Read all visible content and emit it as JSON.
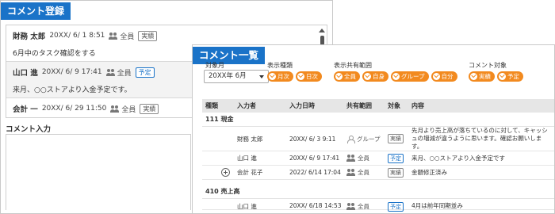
{
  "register": {
    "title": "コメント登録",
    "comments": [
      {
        "name": "財務 太郎",
        "date": "20XX/ 6/ 1 8:51",
        "share": "全員",
        "tag": "実績",
        "tag_style": "gray",
        "body": "6月中のタスク確認をする"
      },
      {
        "name": "山口 進",
        "date": "20XX/ 6/ 9 17:41",
        "share": "全員",
        "tag": "予定",
        "tag_style": "blue",
        "body": "来月、○○ストアより入金予定です。"
      },
      {
        "name": "会計 一",
        "date": "20XX/ 6/ 29 11:50",
        "share": "全員",
        "tag": "実績",
        "tag_style": "gray",
        "body": ""
      }
    ],
    "input_label": "コメント入力"
  },
  "list": {
    "title": "コメント一覧",
    "filters": {
      "month_label": "対象月",
      "month_value": "20XX年 6月",
      "display_type_label": "表示種類",
      "display_type_chips": [
        "月次",
        "日次"
      ],
      "share_scope_label": "表示共有範囲",
      "share_scope_chips": [
        "全員",
        "自身",
        "グループ",
        "自分"
      ],
      "comment_target_label": "コメント対象",
      "comment_target_chips": [
        "実績",
        "予定"
      ]
    },
    "columns": [
      "種類",
      "入力者",
      "入力日時",
      "共有範囲",
      "対象",
      "内容"
    ],
    "groups": [
      {
        "name": "111 現金",
        "rows": [
          {
            "name": "財務 太郎",
            "date": "20XX/ 6/ 3 9:11",
            "share": "グループ",
            "share_icon": "group-icon",
            "target": "実績",
            "target_style": "gray",
            "content": "先月より売上高が落ちているのに対して、キャッシュの増減が違うように思います。確認お願いします。"
          },
          {
            "name": "山口 進",
            "date": "20XX/ 6/ 9 17:41",
            "share": "全員",
            "share_icon": "people-icon",
            "target": "予定",
            "target_style": "blue",
            "content": "来月、○○ストアより入金予定です"
          },
          {
            "name": "会計 花子",
            "date": "2022/ 6/14 17:04",
            "share": "全員",
            "share_icon": "people-icon",
            "target": "実績",
            "target_style": "gray",
            "content": "金額修正済み"
          }
        ]
      },
      {
        "name": "410 売上高",
        "rows": [
          {
            "name": "山口 進",
            "date": "20XX/ 6/18 14:53",
            "share": "全員",
            "share_icon": "people-icon",
            "target": "予定",
            "target_style": "blue",
            "content": "4月は前年同期並み"
          }
        ]
      }
    ]
  },
  "colors": {
    "accent_blue": "#1a73c8",
    "chip_orange": "#f28a1f"
  }
}
